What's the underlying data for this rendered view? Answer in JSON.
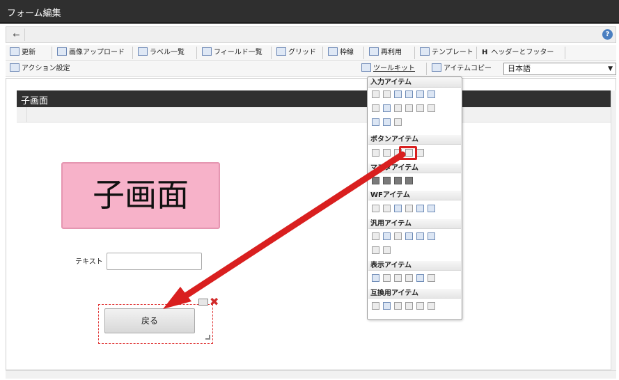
{
  "window": {
    "title": "フォーム編集"
  },
  "nav": {
    "back": "←",
    "help": "?"
  },
  "toolbar1": {
    "items": [
      "更新",
      "画像アップロード",
      "ラベル一覧",
      "フィールド一覧",
      "グリッド",
      "枠線",
      "再利用",
      "テンプレート",
      "ヘッダーとフッター"
    ],
    "header_prefix": "H"
  },
  "toolbar2": {
    "action_settings": "アクション設定",
    "toolkit": "ツールキット",
    "item_copy": "アイテムコピー",
    "language": "日本語",
    "dropdown_arrow": "▼"
  },
  "frame": {
    "title": "子画面"
  },
  "canvas": {
    "big_label": "子画面",
    "text_label": "テキスト",
    "text_value": "",
    "button_label": "戻る"
  },
  "palette": {
    "sections": [
      "入力アイテム",
      "ボタンアイテム",
      "マスタアイテム",
      "WFアイテム",
      "汎用アイテム",
      "表示アイテム",
      "互換用アイテム"
    ]
  },
  "colors": {
    "accent_red": "#d91f1f",
    "pink_label": "#f7b2c9",
    "header_dark": "#2f2f2f"
  }
}
